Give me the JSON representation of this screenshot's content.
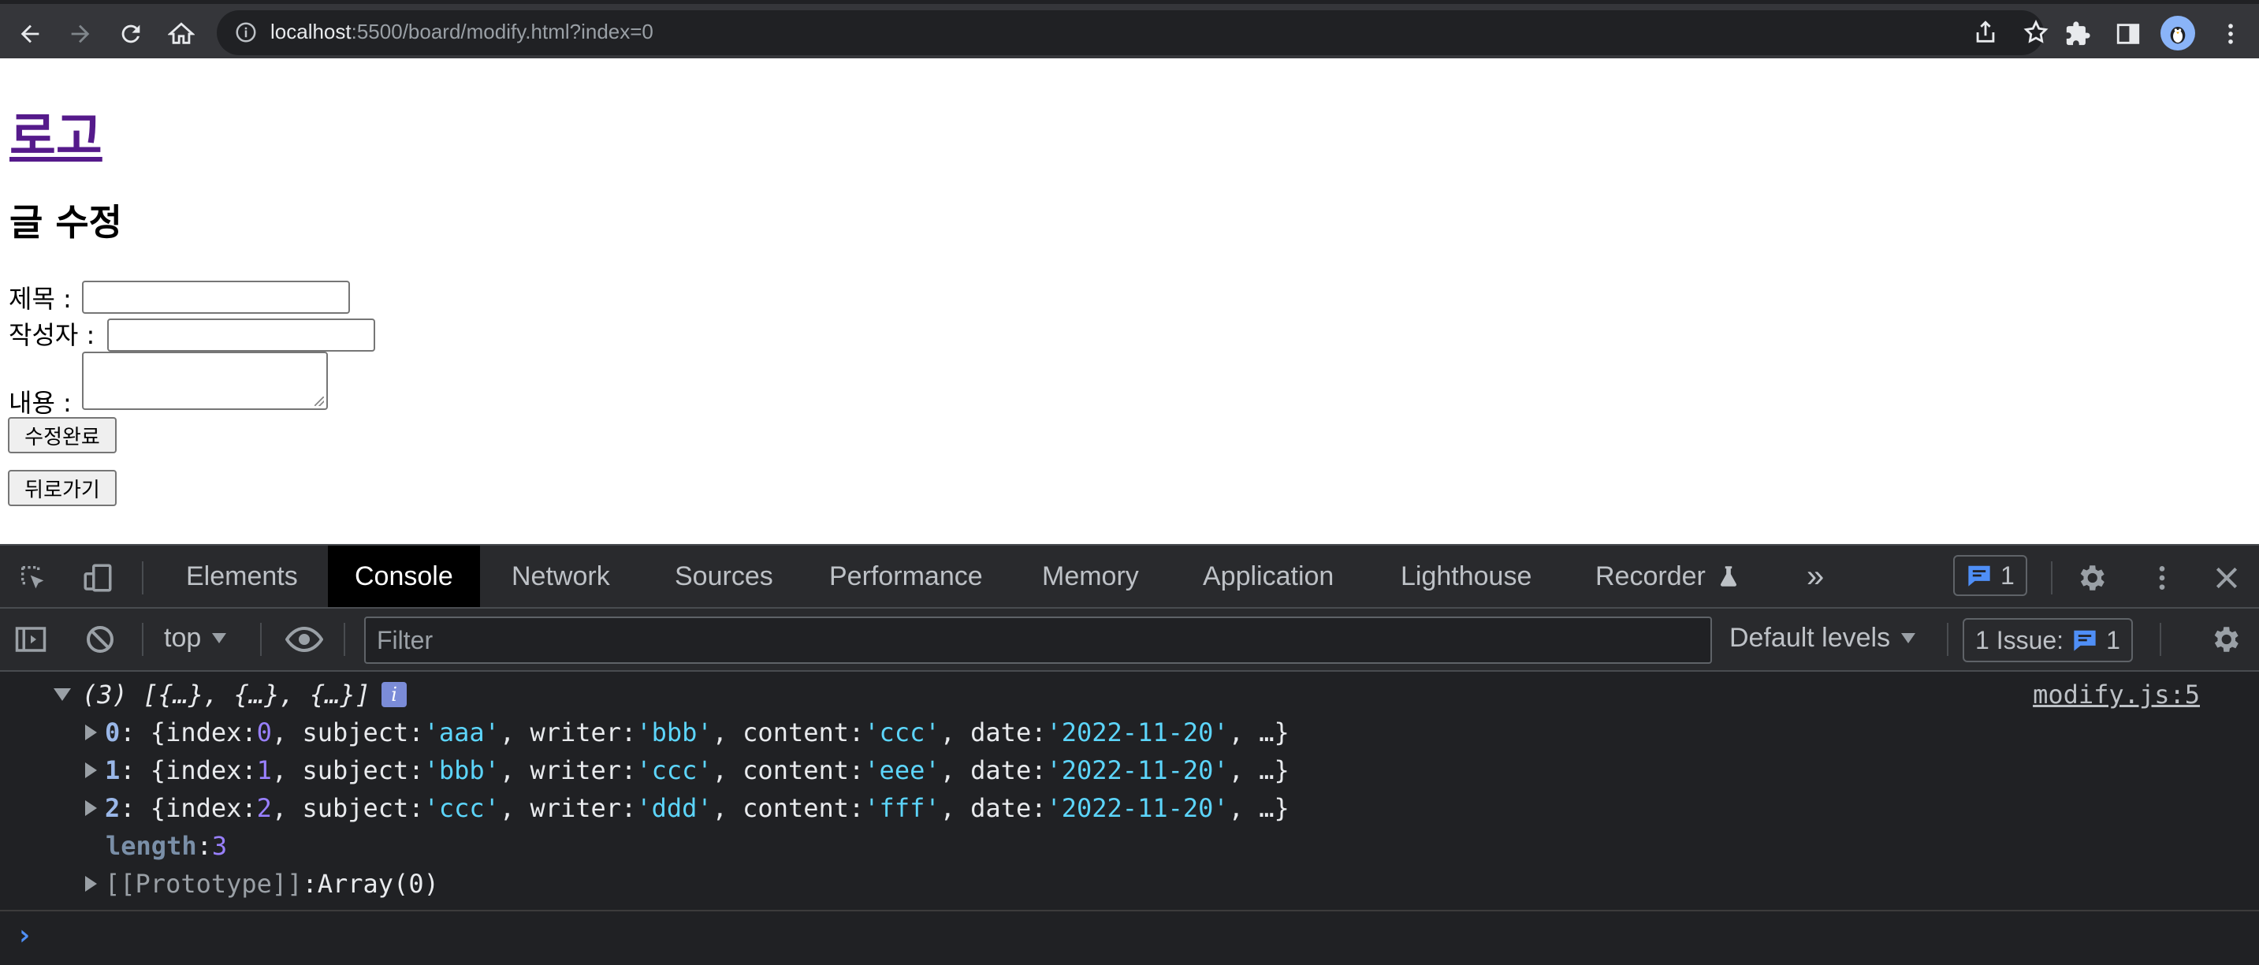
{
  "browser": {
    "url_host": "localhost",
    "url_rest": ":5500/board/modify.html?index=0"
  },
  "page": {
    "logo": "로고",
    "title": "글 수정",
    "form": {
      "subject_label": "제목 :",
      "writer_label": "작성자 :",
      "content_label": "내용 :",
      "subject_value": "",
      "writer_value": "",
      "content_value": ""
    },
    "submit_button": "수정완료",
    "back_button": "뒤로가기"
  },
  "devtools": {
    "tabs": [
      {
        "label": "Elements"
      },
      {
        "label": "Console",
        "active": true
      },
      {
        "label": "Network"
      },
      {
        "label": "Sources"
      },
      {
        "label": "Performance"
      },
      {
        "label": "Memory"
      },
      {
        "label": "Application"
      },
      {
        "label": "Lighthouse"
      },
      {
        "label": "Recorder"
      }
    ],
    "more_tabs": "»",
    "messages_count": "1",
    "context": "top",
    "filter_placeholder": "Filter",
    "levels": "Default levels",
    "issues_label": "1 Issue:",
    "issues_count": "1",
    "console": {
      "summary": "(3) [{…}, {…}, {…}]",
      "info_glyph": "i",
      "source": "modify.js:5",
      "items": [
        {
          "key": "0",
          "index": "0",
          "subject": "'aaa'",
          "writer": "'bbb'",
          "content": "'ccc'",
          "date": "'2022-11-20'"
        },
        {
          "key": "1",
          "index": "1",
          "subject": "'bbb'",
          "writer": "'ccc'",
          "content": "'eee'",
          "date": "'2022-11-20'"
        },
        {
          "key": "2",
          "index": "2",
          "subject": "'ccc'",
          "writer": "'ddd'",
          "content": "'fff'",
          "date": "'2022-11-20'"
        }
      ],
      "length_key": "length",
      "length_value": "3",
      "prototype_key": "[[Prototype]]",
      "prototype_value": "Array(0)",
      "prompt": "›"
    }
  }
}
